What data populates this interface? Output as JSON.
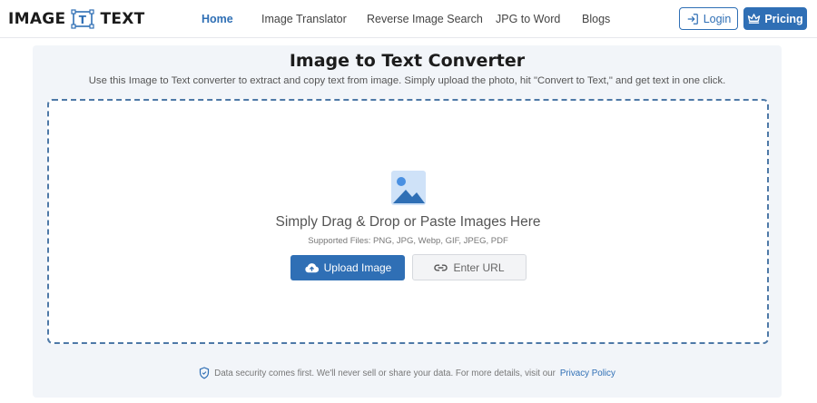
{
  "header": {
    "logo": {
      "left_text": "IMAGE",
      "mark_letter": "T",
      "right_text": "TEXT"
    },
    "nav": [
      {
        "label": "Home",
        "active": true
      },
      {
        "label": "Image Translator",
        "active": false
      },
      {
        "label": "Reverse Image Search",
        "active": false
      },
      {
        "label": "JPG to Word",
        "active": false
      },
      {
        "label": "Blogs",
        "active": false
      }
    ],
    "login_label": "Login",
    "pricing_label": "Pricing"
  },
  "main": {
    "title": "Image to Text Converter",
    "subtitle": "Use this Image to Text converter to extract and copy text from image. Simply upload the photo, hit \"Convert to Text,\" and get text in one click.",
    "dropzone": {
      "icon": "image-icon",
      "heading": "Simply Drag & Drop or Paste Images Here",
      "supported": "Supported Files: PNG, JPG, Webp, GIF, JPEG, PDF",
      "upload_label": "Upload Image",
      "url_label": "Enter URL"
    },
    "security": {
      "text": "Data security comes first. We'll never sell or share your data. For more details, visit our",
      "link": "Privacy Policy"
    }
  },
  "colors": {
    "accent": "#2f6fb5",
    "panel_bg": "#f2f5f9",
    "dropzone_border": "#4e79a7"
  }
}
